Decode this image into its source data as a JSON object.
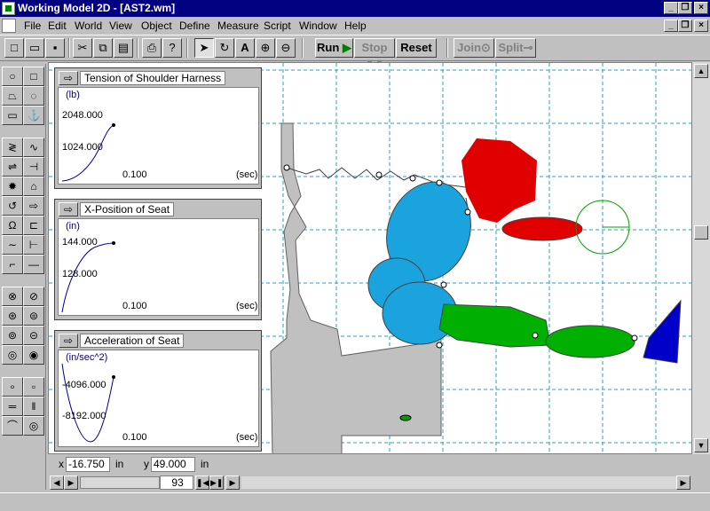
{
  "window": {
    "title": "Working Model 2D - [AST2.wm]"
  },
  "menu": [
    "File",
    "Edit",
    "World",
    "View",
    "Object",
    "Define",
    "Measure",
    "Script",
    "Window",
    "Help"
  ],
  "toolbar": {
    "run": "Run",
    "stop": "Stop",
    "reset": "Reset",
    "join": "Join",
    "split": "Split"
  },
  "meters": [
    {
      "title": "Tension of Shoulder Harness",
      "unit": "(lb)",
      "y_top": "2048.000",
      "y_mid": "1024.000",
      "x_val": "0.100",
      "x_unit": "(sec)"
    },
    {
      "title": "X-Position of Seat",
      "unit": "(in)",
      "y_top": "144.000",
      "y_mid": "128.000",
      "x_val": "0.100",
      "x_unit": "(sec)"
    },
    {
      "title": "Acceleration of Seat",
      "unit": "(in/sec^2)",
      "y_top": "-4096.000",
      "y_mid": "-8192.000",
      "x_val": "0.100",
      "x_unit": "(sec)"
    }
  ],
  "coords": {
    "x_label": "x",
    "x_value": "-16.750",
    "x_unit": "in",
    "y_label": "y",
    "y_value": "49.000",
    "y_unit": "in"
  },
  "hscroll": {
    "frame": "93"
  },
  "colors": {
    "head": "#e00000",
    "torso": "#1ba3dd",
    "legs": "#00b000",
    "foot": "#0000c8",
    "seat": "#c0c0c0",
    "grid": "#20a0c0"
  }
}
